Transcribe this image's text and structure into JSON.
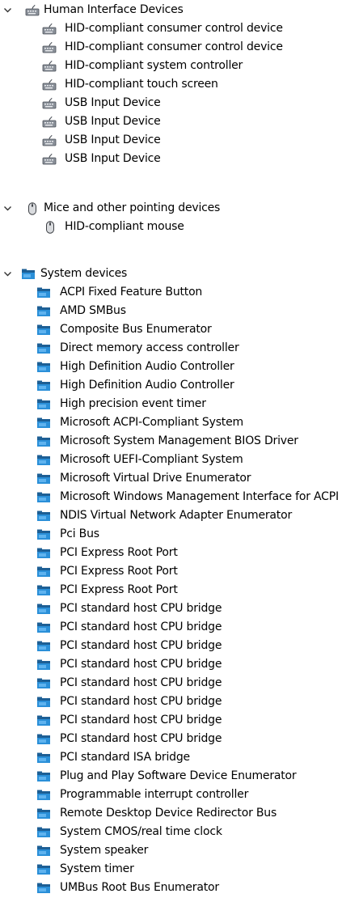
{
  "tree": {
    "hid": {
      "label": "Human Interface Devices",
      "icon": "hid-keyboard-icon",
      "expanded": true,
      "children": [
        "HID-compliant consumer control device",
        "HID-compliant consumer control device",
        "HID-compliant system controller",
        "HID-compliant touch screen",
        "USB Input Device",
        "USB Input Device",
        "USB Input Device",
        "USB Input Device"
      ]
    },
    "mice": {
      "label": "Mice and other pointing devices",
      "icon": "mouse-icon",
      "expanded": true,
      "children": [
        "HID-compliant mouse"
      ]
    },
    "system": {
      "label": "System devices",
      "icon": "system-device-folder-icon",
      "expanded": true,
      "children": [
        "ACPI Fixed Feature Button",
        "AMD SMBus",
        "Composite Bus Enumerator",
        "Direct memory access controller",
        "High Definition Audio Controller",
        "High Definition Audio Controller",
        "High precision event timer",
        "Microsoft ACPI-Compliant System",
        "Microsoft System Management BIOS Driver",
        "Microsoft UEFI-Compliant System",
        "Microsoft Virtual Drive Enumerator",
        "Microsoft Windows Management Interface for ACPI",
        "NDIS Virtual Network Adapter Enumerator",
        "Pci Bus",
        "PCI Express Root Port",
        "PCI Express Root Port",
        "PCI Express Root Port",
        "PCI standard host CPU bridge",
        "PCI standard host CPU bridge",
        "PCI standard host CPU bridge",
        "PCI standard host CPU bridge",
        "PCI standard host CPU bridge",
        "PCI standard host CPU bridge",
        "PCI standard host CPU bridge",
        "PCI standard host CPU bridge",
        "PCI standard ISA bridge",
        "Plug and Play Software Device Enumerator",
        "Programmable interrupt controller",
        "Remote Desktop Device Redirector Bus",
        "System CMOS/real time clock",
        "System speaker",
        "System timer",
        "UMBus Root Bus Enumerator"
      ]
    }
  },
  "colors": {
    "text": "#000000",
    "chevron": "#333333",
    "folder_blue": "#2a8fd8",
    "folder_dark": "#1d5f95",
    "hid_gray": "#7a7f86"
  }
}
